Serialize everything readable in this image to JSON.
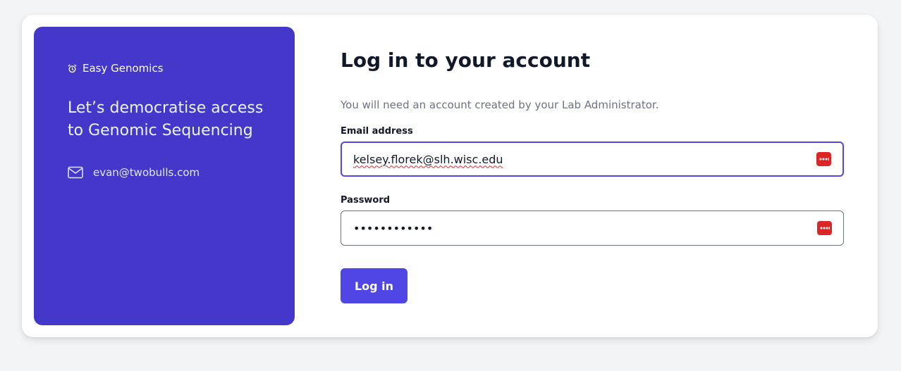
{
  "brand": {
    "name": "Easy Genomics",
    "icon": "alarm-clock-icon"
  },
  "sidebar": {
    "tagline": "Let’s democratise access to Genomic Sequencing",
    "contact_email": "evan@twobulls.com",
    "contact_icon": "mail-icon"
  },
  "form": {
    "title": "Log in to your account",
    "subtitle": "You will need an account created by your Lab Administrator.",
    "email_label": "Email address",
    "email_value": "kelsey.florek@slh.wisc.edu",
    "password_label": "Password",
    "password_value": "••••••••••••",
    "submit_label": "Log in"
  },
  "colors": {
    "sidebar_bg": "#4338ca",
    "primary": "#4f46e5",
    "password_manager_icon": "#dc2626"
  }
}
